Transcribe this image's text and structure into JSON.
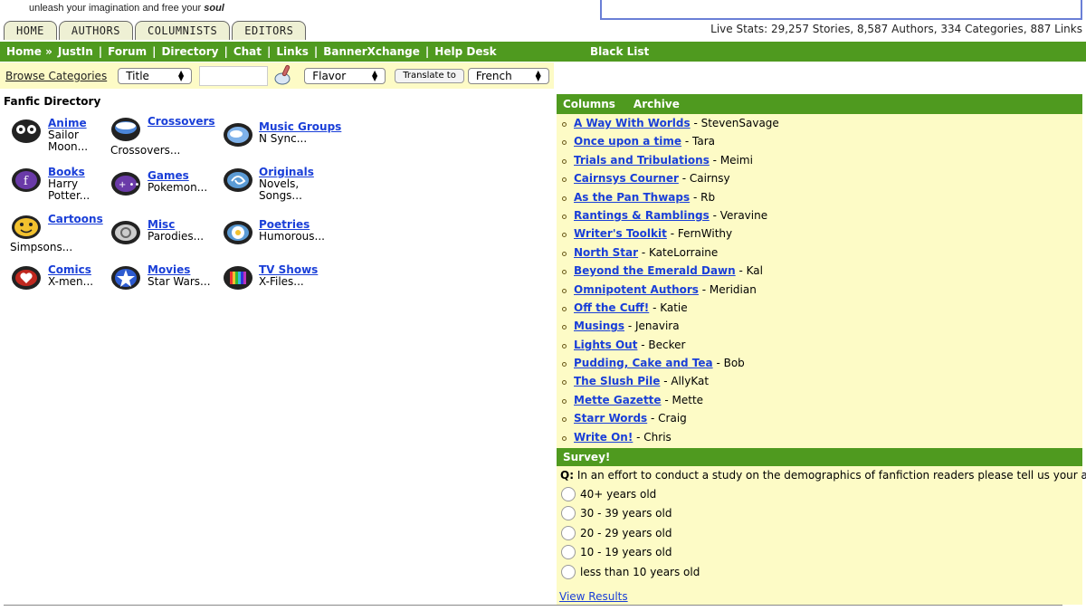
{
  "header": {
    "tagline_prefix": "unleash your imagination and free your",
    "tagline_emph": "soul",
    "tabs": [
      "HOME",
      "AUTHORS",
      "COLUMNISTS",
      "EDITORS"
    ],
    "live_stats": "Live Stats: 29,257 Stories, 8,587 Authors, 334 Categories, 887 Links"
  },
  "nav": {
    "items": [
      "Home »",
      "JustIn",
      "Forum",
      "Directory",
      "Chat",
      "Links",
      "BannerXchange",
      "Help Desk"
    ],
    "separator": "|",
    "black_list": "Black List"
  },
  "toolbar": {
    "browse_label": "Browse Categories",
    "search_by": "Title",
    "flavor": "Flavor",
    "translate_button": "Translate to",
    "language": "French"
  },
  "directory": {
    "title": "Fanfic Directory",
    "categories": [
      {
        "name": "Anime",
        "desc": "Sailor Moon...",
        "icon": "cat-face-icon"
      },
      {
        "name": "Crossovers",
        "desc": "Crossovers...",
        "icon": "bowl-icon"
      },
      {
        "name": "Music Groups",
        "desc": "N Sync...",
        "icon": "cloud-icon"
      },
      {
        "name": "Books",
        "desc": "Harry Potter...",
        "icon": "book-icon"
      },
      {
        "name": "Games",
        "desc": "Pokemon...",
        "icon": "gamepad-icon"
      },
      {
        "name": "Originals",
        "desc": "Novels, Songs...",
        "icon": "swirl-icon"
      },
      {
        "name": "Cartoons",
        "desc": "Simpsons...",
        "icon": "smiley-icon"
      },
      {
        "name": "Misc",
        "desc": "Parodies...",
        "icon": "spiral-icon"
      },
      {
        "name": "Poetries",
        "desc": "Humorous...",
        "icon": "flower-icon"
      },
      {
        "name": "Comics",
        "desc": "X-men...",
        "icon": "heart-icon"
      },
      {
        "name": "Movies",
        "desc": "Star Wars...",
        "icon": "star-icon"
      },
      {
        "name": "TV Shows",
        "desc": "X-Files...",
        "icon": "tv-icon"
      }
    ],
    "desc_lines": {
      "anime": [
        "Sailor",
        "Moon..."
      ],
      "books": [
        "Harry",
        "Potter..."
      ],
      "originals": [
        "Novels,",
        "Songs..."
      ]
    }
  },
  "columns": {
    "header": "Columns",
    "archive_label": "Archive",
    "items": [
      {
        "title": "A Way With Worlds",
        "author": " - StevenSavage"
      },
      {
        "title": "Once upon a time",
        "author": " - Tara"
      },
      {
        "title": "Trials and Tribulations",
        "author": " - Meimi"
      },
      {
        "title": "Cairnsys Courner",
        "author": " - Cairnsy"
      },
      {
        "title": "As the Pan Thwaps",
        "author": " - Rb"
      },
      {
        "title": "Rantings & Ramblings",
        "author": " - Veravine"
      },
      {
        "title": "Writer's Toolkit",
        "author": " - FernWithy"
      },
      {
        "title": "North Star",
        "author": " - KateLorraine"
      },
      {
        "title": "Beyond the Emerald Dawn",
        "author": " - Kal"
      },
      {
        "title": "Omnipotent Authors",
        "author": " - Meridian"
      },
      {
        "title": "Off the Cuff!",
        "author": " - Katie"
      },
      {
        "title": "Musings",
        "author": " - Jenavira"
      },
      {
        "title": "Lights Out",
        "author": " - Becker"
      },
      {
        "title": "Pudding, Cake and Tea",
        "author": " - Bob"
      },
      {
        "title": "The Slush Pile",
        "author": " - AllyKat"
      },
      {
        "title": "Mette Gazette",
        "author": " - Mette"
      },
      {
        "title": "Starr Words",
        "author": " - Craig"
      },
      {
        "title": "Write On!",
        "author": " - Chris"
      }
    ]
  },
  "survey": {
    "header": "Survey!",
    "q_label": "Q:",
    "question": " In an effort to conduct a study on the demographics of fanfiction readers please tell us your age.",
    "options": [
      "40+ years old",
      "30 - 39 years old",
      "20 - 29 years old",
      "10 - 19 years old",
      "less than 10 years old"
    ],
    "view_results": "View Results"
  },
  "colors": {
    "nav_green": "#4f9a1f",
    "panel_yellow": "#fdfbc6",
    "link_blue": "#1a3fd8"
  }
}
